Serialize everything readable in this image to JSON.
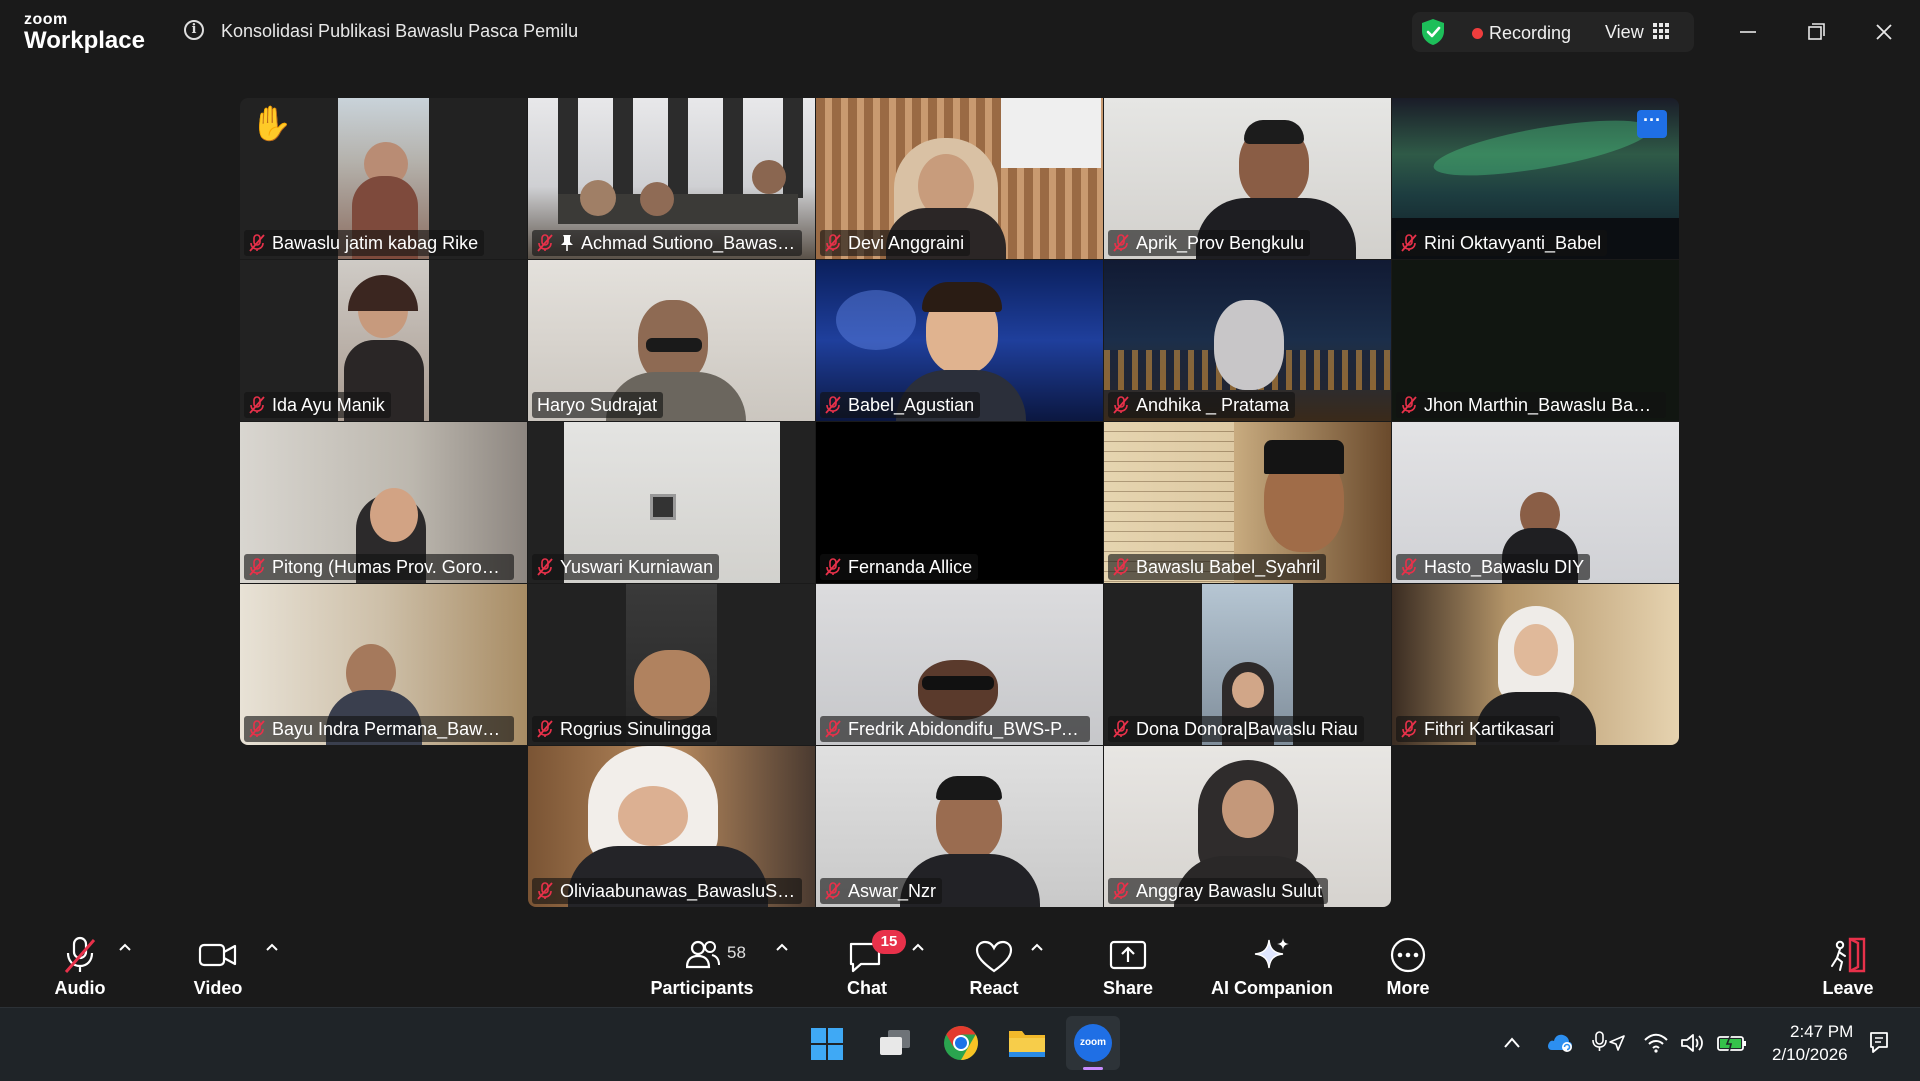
{
  "app": {
    "brand_top": "zoom",
    "brand_bottom": "Workplace",
    "meeting_title": "Konsolidasi Publikasi Bawaslu Pasca Pemilu"
  },
  "header": {
    "recording_label": "Recording",
    "view_label": "View",
    "colors": {
      "shield": "#1dbf5a",
      "recording_dot": "#ef3d3d"
    }
  },
  "participants": [
    {
      "name": "Bawaslu jatim kabag Rike",
      "muted": true,
      "raised_hand": true
    },
    {
      "name": "Achmad Sutiono_Bawasl...",
      "muted": true,
      "pinned": true
    },
    {
      "name": "Devi Anggraini",
      "muted": true
    },
    {
      "name": "Aprik_Prov Bengkulu",
      "muted": true
    },
    {
      "name": "Rini Oktavyanti_Babel",
      "muted": true
    },
    {
      "name": "Ida Ayu Manik",
      "muted": true
    },
    {
      "name": "Haryo Sudrajat",
      "muted": false,
      "active_speaker": true
    },
    {
      "name": "Babel_Agustian",
      "muted": true
    },
    {
      "name": "Andhika _ Pratama",
      "muted": true
    },
    {
      "name": "Jhon Marthin_Bawaslu Bant...",
      "muted": true
    },
    {
      "name": "Pitong (Humas Prov. Goront...",
      "muted": true
    },
    {
      "name": "Yuswari Kurniawan",
      "muted": true
    },
    {
      "name": "Fernanda Allice",
      "muted": true
    },
    {
      "name": "Bawaslu Babel_Syahril",
      "muted": true
    },
    {
      "name": "Hasto_Bawaslu DIY",
      "muted": true
    },
    {
      "name": "Bayu Indra Permana_Bawasl...",
      "muted": true
    },
    {
      "name": "Rogrius Sinulingga",
      "muted": true
    },
    {
      "name": "Fredrik Abidondifu_BWS-PA...",
      "muted": true
    },
    {
      "name": "Dona Donora|Bawaslu Riau",
      "muted": true
    },
    {
      "name": "Fithri Kartikasari",
      "muted": true
    },
    {
      "name": "Oliviaabunawas_BawasluSul...",
      "muted": true
    },
    {
      "name": "Aswar_Nzr",
      "muted": true
    },
    {
      "name": "Anggray Bawaslu Sulut",
      "muted": true
    }
  ],
  "toolbar": {
    "audio": "Audio",
    "video": "Video",
    "participants": "Participants",
    "participant_count": "58",
    "chat": "Chat",
    "chat_badge": "15",
    "react": "React",
    "share": "Share",
    "ai_companion": "AI Companion",
    "more": "More",
    "leave": "Leave",
    "colors": {
      "muted": "#e8314a",
      "badge": "#e8314a",
      "leave": "#e8314a"
    }
  },
  "taskbar": {
    "apps": [
      "windows-start-icon",
      "task-view-icon",
      "chrome-icon",
      "file-explorer-icon",
      "zoom-icon"
    ],
    "zoom_app_label": "zoom",
    "time": "2:47 PM",
    "date": "2/10/2026"
  }
}
